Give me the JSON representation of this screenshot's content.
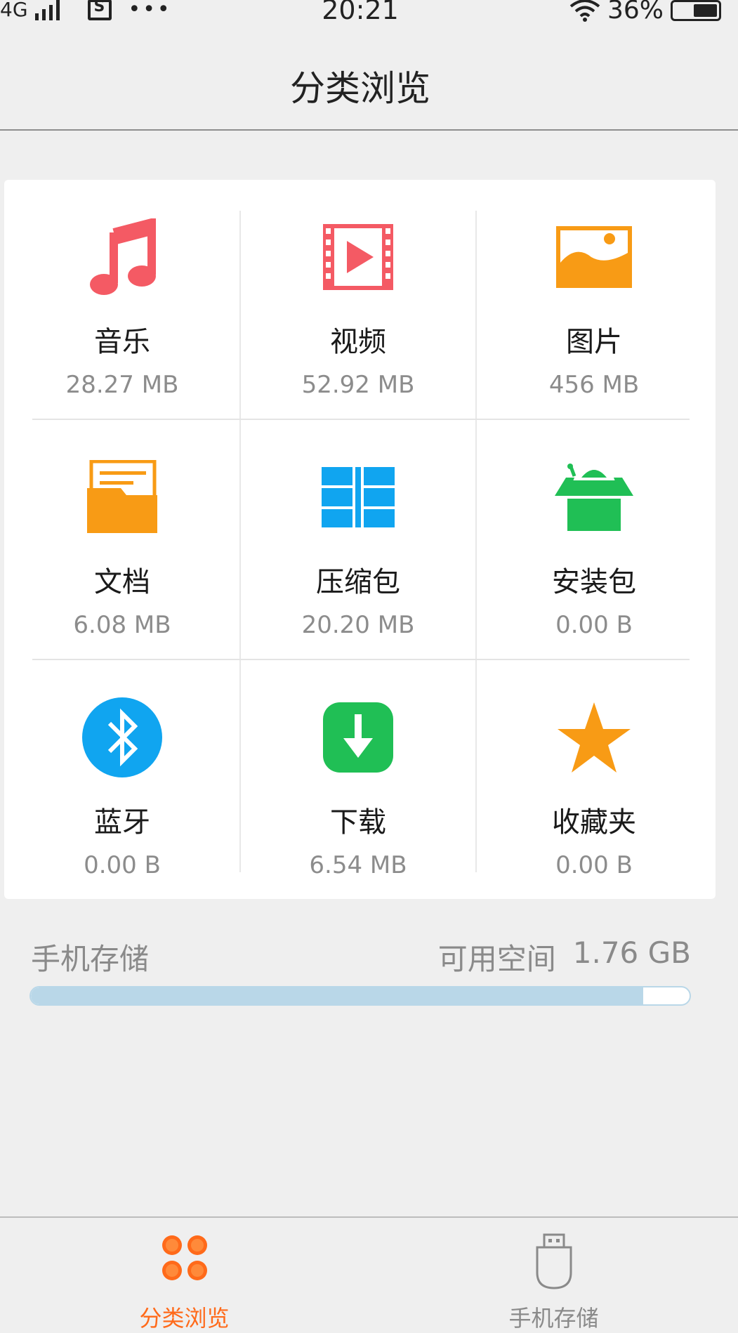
{
  "status_bar": {
    "network": "4G",
    "time": "20:21",
    "battery": "36%"
  },
  "header": {
    "title": "分类浏览"
  },
  "categories": [
    {
      "name": "音乐",
      "size": "28.27 MB",
      "icon": "music-note-icon",
      "color": "#f45a64"
    },
    {
      "name": "视频",
      "size": "52.92 MB",
      "icon": "video-film-icon",
      "color": "#f45a64"
    },
    {
      "name": "图片",
      "size": "456 MB",
      "icon": "picture-icon",
      "color": "#f89b15"
    },
    {
      "name": "文档",
      "size": "6.08 MB",
      "icon": "document-folder-icon",
      "color": "#f89b15"
    },
    {
      "name": "压缩包",
      "size": "20.20 MB",
      "icon": "archive-icon",
      "color": "#10a5f0"
    },
    {
      "name": "安装包",
      "size": "0.00 B",
      "icon": "android-package-icon",
      "color": "#20bf55"
    },
    {
      "name": "蓝牙",
      "size": "0.00 B",
      "icon": "bluetooth-icon",
      "color": "#10a5f0"
    },
    {
      "name": "下载",
      "size": "6.54 MB",
      "icon": "download-icon",
      "color": "#20bf55"
    },
    {
      "name": "收藏夹",
      "size": "0.00 B",
      "icon": "star-icon",
      "color": "#f89b15"
    }
  ],
  "storage": {
    "label": "手机存储",
    "free_label": "可用空间",
    "free_value": "1.76 GB",
    "used_fraction": 0.93
  },
  "bottom_nav": {
    "tabs": [
      {
        "label": "分类浏览",
        "icon": "category-dots-icon",
        "active": true
      },
      {
        "label": "手机存储",
        "icon": "usb-storage-icon",
        "active": false
      }
    ],
    "active_color": "#ff6a1a"
  }
}
